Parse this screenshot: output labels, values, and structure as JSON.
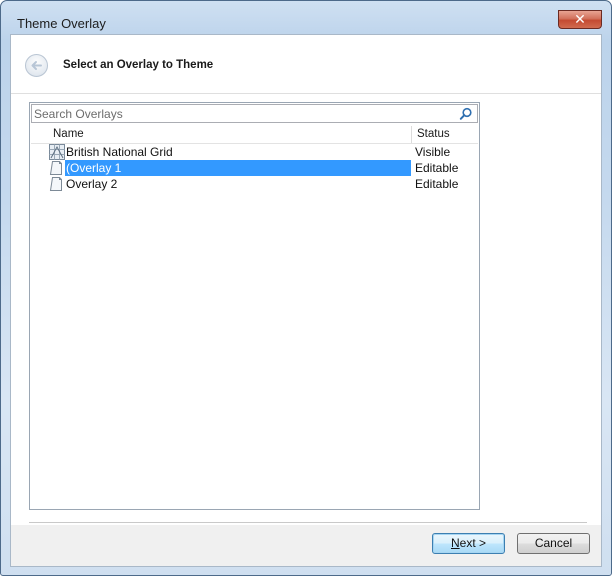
{
  "window": {
    "title": "Theme Overlay",
    "close_glyph": "✕"
  },
  "header": {
    "back_icon": "back-arrow-icon",
    "title": "Select an Overlay to Theme"
  },
  "search": {
    "placeholder": "Search Overlays",
    "value": "",
    "icon": "search-icon"
  },
  "list": {
    "columns": [
      "Name",
      "Status"
    ],
    "rows": [
      {
        "name": "British National Grid",
        "status": "Visible",
        "icon": "grid-icon",
        "selected": false
      },
      {
        "name": "(Overlay 1",
        "status": "Editable",
        "icon": "document-icon",
        "selected": true
      },
      {
        "name": "Overlay 2",
        "status": "Editable",
        "icon": "document-icon",
        "selected": false
      }
    ]
  },
  "buttons": {
    "next_accel": "N",
    "next_rest": "ext >",
    "cancel": "Cancel"
  },
  "colors": {
    "selection": "#3399ff",
    "accent": "#3c7fb1"
  }
}
